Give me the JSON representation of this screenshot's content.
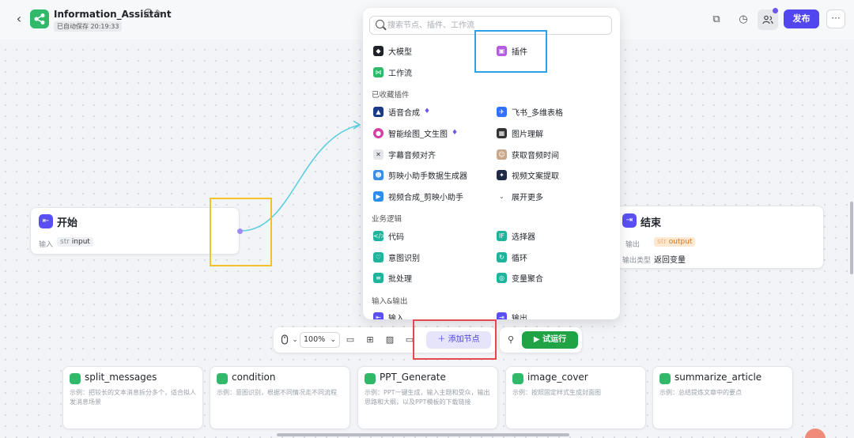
{
  "header": {
    "title": "Information_Assistant",
    "autosave": "已自动保存 20:19:33",
    "publish_label": "发布",
    "more_label": "···"
  },
  "start_node": {
    "title": "开始",
    "input_label": "输入",
    "input_type": "str",
    "input_value": "input"
  },
  "end_node": {
    "title": "结束",
    "output_label": "输出",
    "output_type": "str",
    "output_value": "output",
    "output_kind_label": "输出类型",
    "output_kind_value": "返回变量"
  },
  "popup": {
    "search_placeholder": "搜索节点、插件、工作流",
    "top_items": [
      {
        "label": "大模型",
        "icon": "model-icon",
        "color": "#1f2329"
      },
      {
        "label": "插件",
        "icon": "plugin-icon",
        "color": "#b35ce0"
      },
      {
        "label": "工作流",
        "icon": "workflow-icon",
        "color": "#2fb968"
      }
    ],
    "favorites_title": "已收藏插件",
    "favorites": [
      {
        "label": "语音合成",
        "badge": true,
        "icon": "speech-synthesis-icon",
        "color": "#1b3a8a"
      },
      {
        "label": "飞书_多维表格",
        "badge": false,
        "icon": "feishu-bitable-icon",
        "color": "#3370ff"
      },
      {
        "label": "智能绘图_文生图",
        "badge": true,
        "icon": "ai-drawing-icon",
        "color": "#d43fa4"
      },
      {
        "label": "图片理解",
        "badge": false,
        "icon": "image-understanding-icon",
        "color": "#333333"
      },
      {
        "label": "字幕音频对齐",
        "badge": false,
        "icon": "subtitle-align-icon",
        "color": "#e5e6eb"
      },
      {
        "label": "获取音频时间",
        "badge": false,
        "icon": "audio-time-icon",
        "color": "#c9a88a"
      },
      {
        "label": "剪映小助手数据生成器",
        "badge": false,
        "icon": "jianying-data-icon",
        "color": "#3a8ee6"
      },
      {
        "label": "视频文案提取",
        "badge": false,
        "icon": "video-text-icon",
        "color": "#1f2a44"
      },
      {
        "label": "视频合成_剪映小助手",
        "badge": false,
        "icon": "video-compose-icon",
        "color": "#2d8cf0"
      },
      {
        "label": "展开更多",
        "badge": false,
        "icon": "chevron-down-icon",
        "color": "#ffffff"
      }
    ],
    "logic_title": "业务逻辑",
    "logic": [
      {
        "label": "代码",
        "icon": "code-icon",
        "color": "#1eb49b"
      },
      {
        "label": "选择器",
        "icon": "selector-icon",
        "color": "#1eb49b"
      },
      {
        "label": "意图识别",
        "icon": "intent-icon",
        "color": "#1eb49b"
      },
      {
        "label": "循环",
        "icon": "loop-icon",
        "color": "#1eb49b"
      },
      {
        "label": "批处理",
        "icon": "batch-icon",
        "color": "#1eb49b"
      },
      {
        "label": "变量聚合",
        "icon": "variable-merge-icon",
        "color": "#1eb49b"
      }
    ],
    "io_title": "输入&输出",
    "io": [
      {
        "label": "输入",
        "icon": "input-icon",
        "color": "#5a4ff3"
      },
      {
        "label": "输出",
        "icon": "output-icon",
        "color": "#5a4ff3"
      }
    ]
  },
  "toolbar": {
    "zoom": "100%",
    "add_node_label": "添加节点",
    "run_label": "试运行"
  },
  "cards": [
    {
      "title": "split_messages",
      "desc": "示例：把较长的文本消息拆分多个，适合拟人发消息场景"
    },
    {
      "title": "condition",
      "desc": "示例：意图识别，根据不同情况走不同流程"
    },
    {
      "title": "PPT_Generate",
      "desc": "示例：PPT一键生成，输入主题和受众，输出思路和大纲，以及PPT模板的下载链接"
    },
    {
      "title": "image_cover",
      "desc": "示例：按照固定样式生成封面图"
    },
    {
      "title": "summarize_article",
      "desc": "示例：总结提炼文章中的要点"
    }
  ],
  "colors": {
    "accent": "#5146f0",
    "run": "#1fa345",
    "workflow_green": "#2fb968",
    "highlight_yellow": "#f4c02b",
    "highlight_blue": "#2da2e8",
    "highlight_red": "#e5484d",
    "connector": "#5ccfe0"
  }
}
